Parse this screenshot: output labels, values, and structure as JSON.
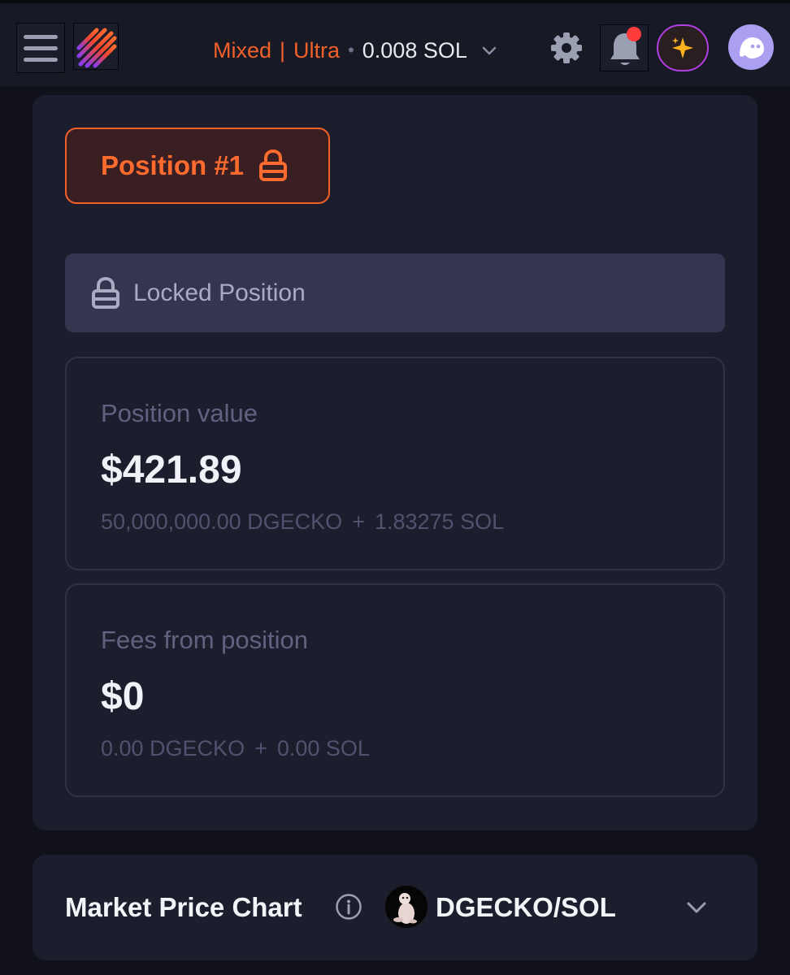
{
  "header": {
    "mode_mixed": "Mixed",
    "mode_separator": "|",
    "mode_ultra": "Ultra",
    "dot": "•",
    "balance": "0.008 SOL",
    "icons": [
      "menu-icon",
      "logo-icon",
      "chevron-down-icon",
      "gear-icon",
      "bell-icon",
      "sparkle-icon",
      "ghost-avatar-icon"
    ],
    "colors": {
      "accent": "#f3612a",
      "notification": "#ff3b3b",
      "avatar": "#ab9ff2"
    }
  },
  "position": {
    "title": "Position #1",
    "locked_label": "Locked Position"
  },
  "position_value": {
    "label": "Position value",
    "value": "$421.89",
    "token_amount": "50,000,000.00 DGECKO",
    "plus": "+",
    "sol_amount": "1.83275 SOL"
  },
  "fees": {
    "label": "Fees from position",
    "value": "$0",
    "token_amount": "0.00 DGECKO",
    "plus": "+",
    "sol_amount": "0.00 SOL"
  },
  "chart": {
    "title": "Market Price Chart",
    "pair": "DGECKO/SOL"
  }
}
